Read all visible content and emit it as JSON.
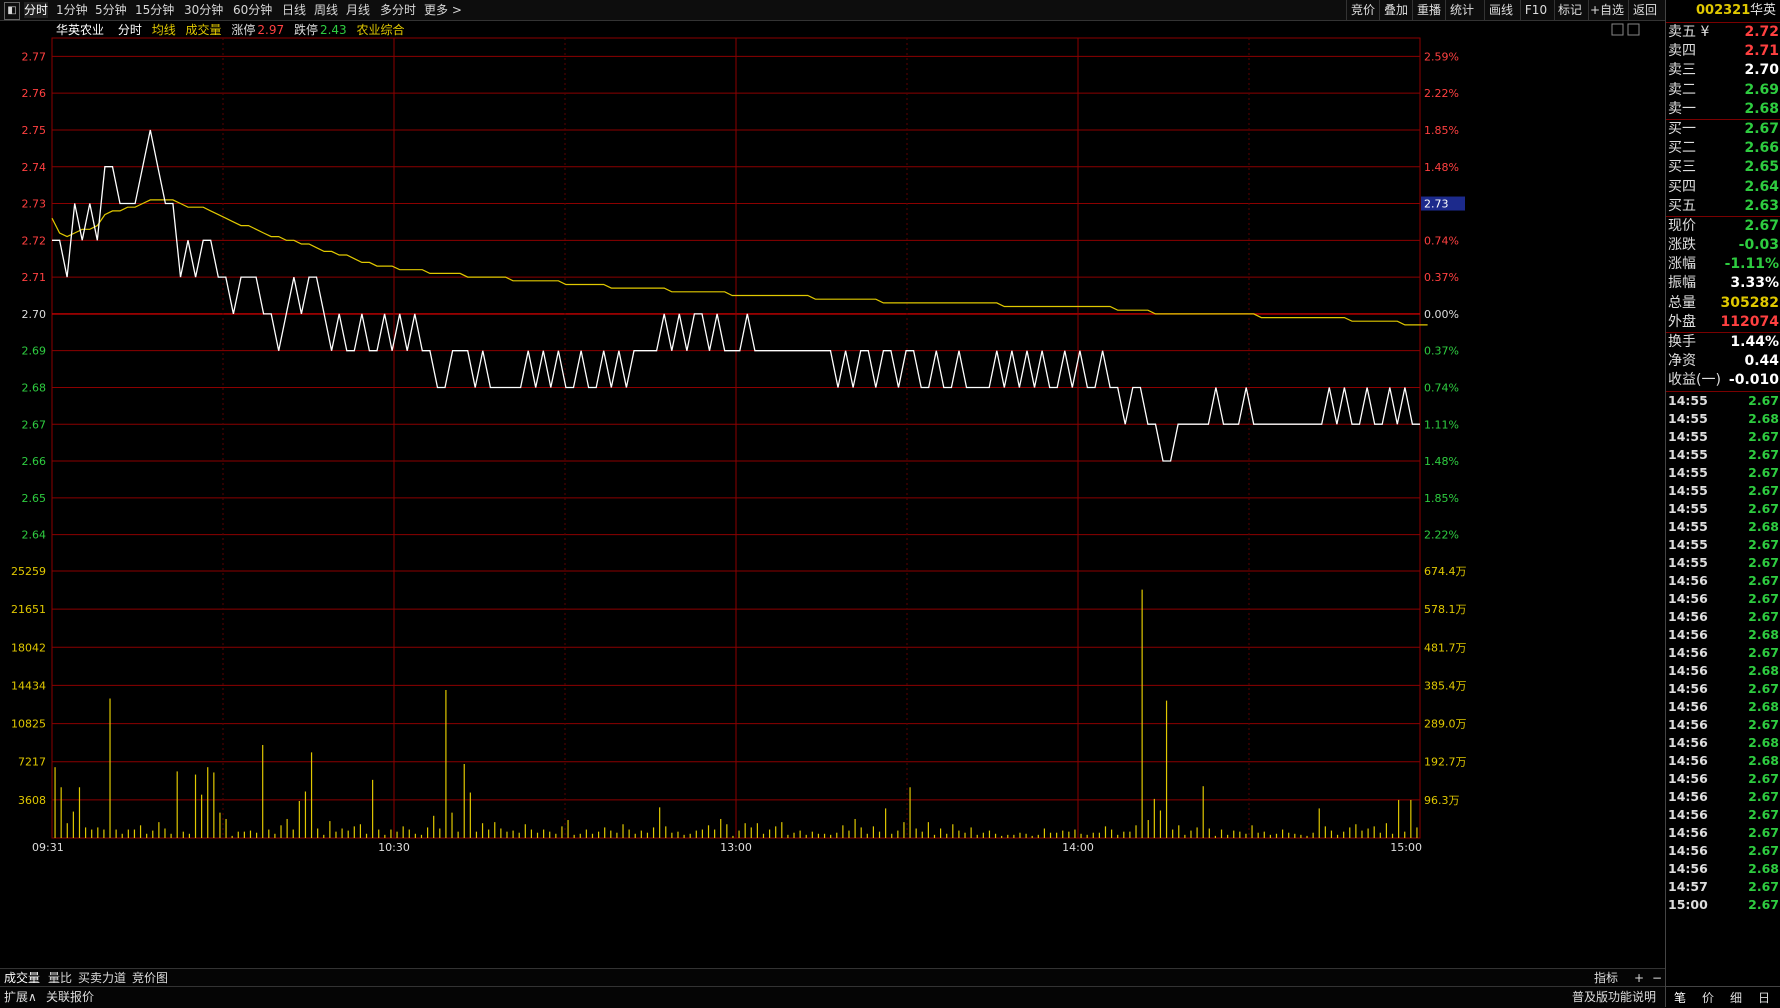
{
  "toolbar": {
    "tabs": [
      "分时",
      "1分钟",
      "5分钟",
      "15分钟",
      "30分钟",
      "60分钟",
      "日线",
      "周线",
      "月线",
      "多分时",
      "更多 >"
    ],
    "right_buttons": [
      "竞价",
      "叠加",
      "重播",
      "统计",
      "画线",
      "F10",
      "标记",
      "+自选",
      "返回"
    ]
  },
  "legend": {
    "name": "华英农业",
    "mode": "分时",
    "avg_label": "均线",
    "vol_label": "成交量",
    "limit_up_label": "涨停",
    "limit_up": "2.97",
    "limit_down_label": "跌停",
    "limit_down": "2.43",
    "sector": "农业综合"
  },
  "chart_data": {
    "type": "line",
    "price_axis": [
      "2.77",
      "2.76",
      "2.75",
      "2.74",
      "2.73",
      "2.72",
      "2.71",
      "2.70",
      "2.69",
      "2.68",
      "2.67",
      "2.66",
      "2.65",
      "2.64"
    ],
    "pct_axis": [
      "2.59%",
      "2.22%",
      "1.85%",
      "1.48%",
      "1.11%",
      "0.74%",
      "0.37%",
      "0.00%",
      "0.37%",
      "0.74%",
      "1.11%",
      "1.48%",
      "1.85%",
      "2.22%"
    ],
    "vol_axis": [
      "25259",
      "21651",
      "18042",
      "14434",
      "10825",
      "7217",
      "3608"
    ],
    "vol_axis_right": [
      "674.4万",
      "578.1万",
      "481.7万",
      "385.4万",
      "289.0万",
      "192.7万",
      "96.3万"
    ],
    "time_labels": [
      "09:31",
      "10:30",
      "13:00",
      "14:00",
      "15:00"
    ],
    "current_price_tag": "2.73",
    "prev_close": 2.7,
    "ylim": [
      2.635,
      2.775
    ],
    "price_series": [
      2.72,
      2.72,
      2.71,
      2.73,
      2.72,
      2.73,
      2.72,
      2.74,
      2.74,
      2.73,
      2.73,
      2.73,
      2.74,
      2.75,
      2.74,
      2.73,
      2.73,
      2.71,
      2.72,
      2.71,
      2.72,
      2.72,
      2.71,
      2.71,
      2.7,
      2.71,
      2.71,
      2.71,
      2.7,
      2.7,
      2.69,
      2.7,
      2.71,
      2.7,
      2.71,
      2.71,
      2.7,
      2.69,
      2.7,
      2.69,
      2.69,
      2.7,
      2.69,
      2.69,
      2.7,
      2.69,
      2.7,
      2.69,
      2.7,
      2.69,
      2.69,
      2.68,
      2.68,
      2.69,
      2.69,
      2.69,
      2.68,
      2.69,
      2.68,
      2.68,
      2.68,
      2.68,
      2.68,
      2.69,
      2.68,
      2.69,
      2.68,
      2.69,
      2.68,
      2.68,
      2.69,
      2.68,
      2.68,
      2.69,
      2.68,
      2.69,
      2.68,
      2.69,
      2.69,
      2.69,
      2.69,
      2.7,
      2.69,
      2.7,
      2.69,
      2.7,
      2.7,
      2.69,
      2.7,
      2.69,
      2.69,
      2.69,
      2.7,
      2.69,
      2.69,
      2.69,
      2.69,
      2.69,
      2.69,
      2.69,
      2.69,
      2.69,
      2.69,
      2.69,
      2.68,
      2.69,
      2.68,
      2.69,
      2.69,
      2.68,
      2.69,
      2.69,
      2.68,
      2.69,
      2.69,
      2.68,
      2.68,
      2.69,
      2.68,
      2.68,
      2.69,
      2.68,
      2.68,
      2.68,
      2.68,
      2.69,
      2.68,
      2.69,
      2.68,
      2.69,
      2.68,
      2.69,
      2.68,
      2.68,
      2.69,
      2.68,
      2.69,
      2.68,
      2.68,
      2.69,
      2.68,
      2.68,
      2.67,
      2.68,
      2.68,
      2.67,
      2.67,
      2.66,
      2.66,
      2.67,
      2.67,
      2.67,
      2.67,
      2.67,
      2.68,
      2.67,
      2.67,
      2.67,
      2.68,
      2.67,
      2.67,
      2.67,
      2.67,
      2.67,
      2.67,
      2.67,
      2.67,
      2.67,
      2.67,
      2.68,
      2.67,
      2.68,
      2.67,
      2.67,
      2.68,
      2.67,
      2.67,
      2.68,
      2.67,
      2.68,
      2.67,
      2.67
    ],
    "avg_series": [
      2.726,
      2.722,
      2.721,
      2.722,
      2.723,
      2.723,
      2.724,
      2.727,
      2.728,
      2.728,
      2.729,
      2.729,
      2.73,
      2.731,
      2.731,
      2.731,
      2.731,
      2.73,
      2.729,
      2.729,
      2.729,
      2.728,
      2.727,
      2.726,
      2.725,
      2.724,
      2.724,
      2.723,
      2.722,
      2.721,
      2.721,
      2.72,
      2.72,
      2.719,
      2.719,
      2.718,
      2.717,
      2.717,
      2.716,
      2.716,
      2.715,
      2.714,
      2.714,
      2.713,
      2.713,
      2.713,
      2.712,
      2.712,
      2.712,
      2.712,
      2.711,
      2.711,
      2.711,
      2.711,
      2.711,
      2.71,
      2.71,
      2.71,
      2.71,
      2.71,
      2.71,
      2.709,
      2.709,
      2.709,
      2.709,
      2.709,
      2.709,
      2.709,
      2.708,
      2.708,
      2.708,
      2.708,
      2.708,
      2.708,
      2.707,
      2.707,
      2.707,
      2.707,
      2.707,
      2.707,
      2.707,
      2.707,
      2.706,
      2.706,
      2.706,
      2.706,
      2.706,
      2.706,
      2.706,
      2.706,
      2.705,
      2.705,
      2.705,
      2.705,
      2.705,
      2.705,
      2.705,
      2.705,
      2.705,
      2.705,
      2.705,
      2.704,
      2.704,
      2.704,
      2.704,
      2.704,
      2.704,
      2.704,
      2.704,
      2.704,
      2.703,
      2.703,
      2.703,
      2.703,
      2.703,
      2.703,
      2.703,
      2.703,
      2.703,
      2.703,
      2.703,
      2.703,
      2.703,
      2.703,
      2.703,
      2.703,
      2.702,
      2.702,
      2.702,
      2.702,
      2.702,
      2.702,
      2.702,
      2.702,
      2.702,
      2.702,
      2.702,
      2.702,
      2.702,
      2.702,
      2.702,
      2.701,
      2.701,
      2.701,
      2.701,
      2.701,
      2.7,
      2.7,
      2.7,
      2.7,
      2.7,
      2.7,
      2.7,
      2.7,
      2.7,
      2.7,
      2.7,
      2.7,
      2.7,
      2.7,
      2.699,
      2.699,
      2.699,
      2.699,
      2.699,
      2.699,
      2.699,
      2.699,
      2.699,
      2.699,
      2.699,
      2.699,
      2.698,
      2.698,
      2.698,
      2.698,
      2.698,
      2.698,
      2.698,
      2.697,
      2.697,
      2.697,
      2.697
    ],
    "volume_series": [
      6700,
      4800,
      1400,
      2500,
      4800,
      1000,
      800,
      1000,
      800,
      13200,
      800,
      400,
      800,
      800,
      1200,
      400,
      700,
      1500,
      900,
      400,
      6300,
      600,
      400,
      6000,
      4100,
      6700,
      6200,
      2400,
      1800,
      200,
      600,
      600,
      700,
      500,
      8800,
      800,
      400,
      1200,
      1800,
      800,
      3500,
      4400,
      8100,
      900,
      300,
      1600,
      600,
      900,
      700,
      1100,
      1300,
      400,
      5500,
      800,
      300,
      800,
      600,
      1100,
      800,
      400,
      300,
      1000,
      2100,
      900,
      14000,
      2400,
      600,
      7000,
      4300,
      600,
      1400,
      800,
      1500,
      900,
      600,
      700,
      500,
      1300,
      800,
      500,
      800,
      600,
      400,
      1100,
      1700,
      300,
      400,
      800,
      400,
      600,
      1000,
      700,
      500,
      1300,
      800,
      400,
      700,
      500,
      1000,
      2900,
      1100,
      500,
      600,
      300,
      400,
      700,
      800,
      1200,
      800,
      1800,
      1300,
      200,
      700,
      1400,
      1000,
      1400,
      400,
      800,
      1100,
      1500,
      300,
      500,
      700,
      300,
      600,
      400,
      400,
      300,
      500,
      1200,
      700,
      1800,
      1000,
      400,
      1100,
      600,
      2800,
      400,
      700,
      1500,
      4800,
      900,
      600,
      1500,
      300,
      900,
      400,
      1300,
      700,
      500,
      1000,
      300,
      500,
      700,
      400,
      200,
      300,
      300,
      500,
      400,
      200,
      300,
      900,
      500,
      500,
      700,
      600,
      800,
      400,
      300,
      500,
      500,
      1100,
      800,
      300,
      600,
      600,
      1200,
      23500,
      1700,
      3700,
      2600,
      13000,
      800,
      1200,
      300,
      700,
      1000,
      4900,
      900,
      200,
      800,
      300,
      700,
      600,
      400,
      1200,
      500,
      600,
      300,
      400,
      800,
      500,
      400,
      300,
      200,
      500,
      2800,
      1100,
      700,
      300,
      600,
      1000,
      1300,
      700,
      900,
      1100,
      500,
      1400,
      400,
      3600,
      600,
      3600,
      1000
    ]
  },
  "right_panel": {
    "code": "002321",
    "name": "华英",
    "asks": [
      {
        "label": "卖五 ¥",
        "price": "2.72",
        "color": "#ff4040"
      },
      {
        "label": "卖四",
        "price": "2.71",
        "color": "#ff4040"
      },
      {
        "label": "卖三",
        "price": "2.70",
        "color": "#ffffff"
      },
      {
        "label": "卖二",
        "price": "2.69",
        "color": "#2ecc40"
      },
      {
        "label": "卖一",
        "price": "2.68",
        "color": "#2ecc40"
      }
    ],
    "bids": [
      {
        "label": "买一",
        "price": "2.67",
        "color": "#2ecc40"
      },
      {
        "label": "买二",
        "price": "2.66",
        "color": "#2ecc40"
      },
      {
        "label": "买三",
        "price": "2.65",
        "color": "#2ecc40"
      },
      {
        "label": "买四",
        "price": "2.64",
        "color": "#2ecc40"
      },
      {
        "label": "买五",
        "price": "2.63",
        "color": "#2ecc40"
      }
    ],
    "stats1": [
      {
        "label": "现价",
        "value": "2.67",
        "color": "#2ecc40"
      },
      {
        "label": "涨跌",
        "value": "-0.03",
        "color": "#2ecc40"
      },
      {
        "label": "涨幅",
        "value": "-1.11%",
        "color": "#2ecc40"
      },
      {
        "label": "振幅",
        "value": "3.33%",
        "color": "#ffffff"
      },
      {
        "label": "总量",
        "value": "305282",
        "color": "#e0c800"
      },
      {
        "label": "外盘",
        "value": "112074",
        "color": "#ff4040"
      }
    ],
    "stats2": [
      {
        "label": "换手",
        "value": "1.44%",
        "color": "#ffffff"
      },
      {
        "label": "净资",
        "value": "0.44",
        "color": "#ffffff"
      },
      {
        "label": "收益(一)",
        "value": "-0.010",
        "color": "#ffffff"
      }
    ],
    "ticks": [
      {
        "t": "14:55",
        "p": "2.67"
      },
      {
        "t": "14:55",
        "p": "2.68"
      },
      {
        "t": "14:55",
        "p": "2.67"
      },
      {
        "t": "14:55",
        "p": "2.67"
      },
      {
        "t": "14:55",
        "p": "2.67"
      },
      {
        "t": "14:55",
        "p": "2.67"
      },
      {
        "t": "14:55",
        "p": "2.67"
      },
      {
        "t": "14:55",
        "p": "2.68"
      },
      {
        "t": "14:55",
        "p": "2.67"
      },
      {
        "t": "14:55",
        "p": "2.67"
      },
      {
        "t": "14:56",
        "p": "2.67"
      },
      {
        "t": "14:56",
        "p": "2.67"
      },
      {
        "t": "14:56",
        "p": "2.67"
      },
      {
        "t": "14:56",
        "p": "2.68"
      },
      {
        "t": "14:56",
        "p": "2.67"
      },
      {
        "t": "14:56",
        "p": "2.68"
      },
      {
        "t": "14:56",
        "p": "2.67"
      },
      {
        "t": "14:56",
        "p": "2.68"
      },
      {
        "t": "14:56",
        "p": "2.67"
      },
      {
        "t": "14:56",
        "p": "2.68"
      },
      {
        "t": "14:56",
        "p": "2.68"
      },
      {
        "t": "14:56",
        "p": "2.67"
      },
      {
        "t": "14:56",
        "p": "2.67"
      },
      {
        "t": "14:56",
        "p": "2.67"
      },
      {
        "t": "14:56",
        "p": "2.67"
      },
      {
        "t": "14:56",
        "p": "2.67"
      },
      {
        "t": "14:56",
        "p": "2.68"
      },
      {
        "t": "14:57",
        "p": "2.67"
      },
      {
        "t": "15:00",
        "p": "2.67"
      }
    ],
    "footer": [
      "笔",
      "价",
      "细",
      "日"
    ]
  },
  "bottom": {
    "tabs": [
      "成交量",
      "量比",
      "买卖力道",
      "竞价图"
    ],
    "right": [
      "指标",
      "+",
      "−"
    ],
    "row2_left": [
      "扩展∧",
      "关联报价"
    ],
    "row2_right": "普及版功能说明"
  }
}
